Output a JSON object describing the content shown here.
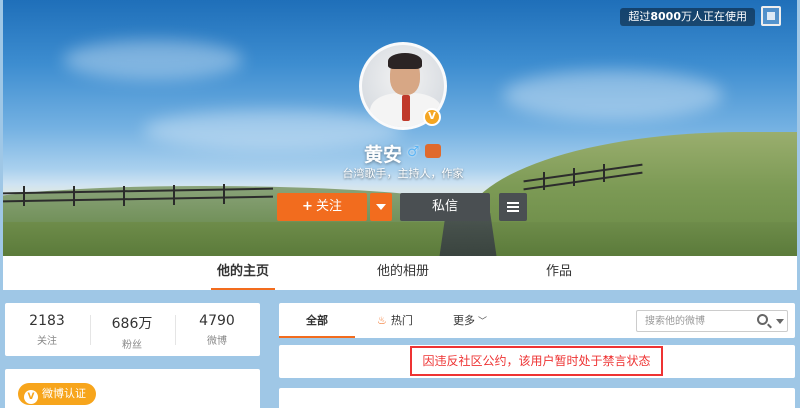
{
  "banner": {
    "users_badge_prefix": "超过",
    "users_badge_count": "8000",
    "users_badge_suffix": "万人正在使用"
  },
  "profile": {
    "name": "黄安",
    "description": "台湾歌手，主持人，作家",
    "verified_mark": "V"
  },
  "actions": {
    "follow_plus": "+",
    "follow_label": "关注",
    "message_label": "私信"
  },
  "tabs": [
    {
      "label": "他的主页",
      "active": true
    },
    {
      "label": "他的相册",
      "active": false
    },
    {
      "label": "作品",
      "active": false
    }
  ],
  "stats": [
    {
      "value": "2183",
      "label": "关注"
    },
    {
      "value": "686万",
      "label": "粉丝"
    },
    {
      "value": "4790",
      "label": "微博"
    }
  ],
  "verify": {
    "mark": "V",
    "label": "微博认证"
  },
  "feed_tabs": {
    "all": "全部",
    "hot": "热门",
    "more": "更多"
  },
  "search": {
    "placeholder": "搜索他的微博"
  },
  "notice": "因违反社区公约，该用户暂时处于禁言状态",
  "colors": {
    "accent": "#f26c1e",
    "notice_red": "#e33333",
    "badge_gold": "#f7a51c"
  }
}
